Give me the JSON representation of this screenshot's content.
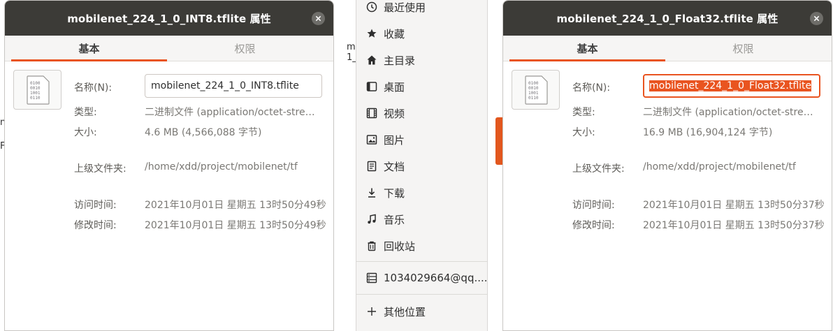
{
  "background": {
    "fragments": [
      "m\n1_",
      "n",
      "F"
    ],
    "accent_color": "#e2571e"
  },
  "sidebar": {
    "items": [
      {
        "icon": "clock-icon",
        "label": "最近使用"
      },
      {
        "icon": "star-icon",
        "label": "收藏"
      },
      {
        "icon": "home-icon",
        "label": "主目录"
      },
      {
        "icon": "desktop-icon",
        "label": "桌面"
      },
      {
        "icon": "video-icon",
        "label": "视频"
      },
      {
        "icon": "picture-icon",
        "label": "图片"
      },
      {
        "icon": "document-icon",
        "label": "文档"
      },
      {
        "icon": "download-icon",
        "label": "下载"
      },
      {
        "icon": "music-icon",
        "label": "音乐"
      },
      {
        "icon": "trash-icon",
        "label": "回收站"
      },
      {
        "icon": "network-server-icon",
        "label": "1034029664@qq...."
      },
      {
        "icon": "plus-icon",
        "label": "其他位置"
      }
    ]
  },
  "dialog_left": {
    "title": "mobilenet_224_1_0_INT8.tflite 属性",
    "tabs": [
      "基本",
      "权限"
    ],
    "active_tab": "基本",
    "name_label": "名称(N):",
    "name_value": "mobilenet_224_1_0_INT8.tflite",
    "type_label": "类型:",
    "type_value": "二进制文件 (application/octet-stream)",
    "size_label": "大小:",
    "size_value": "4.6 MB (4,566,088 字节)",
    "parent_label": "上级文件夹:",
    "parent_value": "/home/xdd/project/mobilenet/tf",
    "accessed_label": "访问时间:",
    "accessed_value": "2021年10月01日 星期五 13时50分49秒",
    "modified_label": "修改时间:",
    "modified_value": "2021年10月01日 星期五 13时50分49秒"
  },
  "dialog_right": {
    "title": "mobilenet_224_1_0_Float32.tflite 属性",
    "tabs": [
      "基本",
      "权限"
    ],
    "active_tab": "基本",
    "name_label": "名称(N):",
    "name_value": "mobilenet_224_1_0_Float32.tflite",
    "type_label": "类型:",
    "type_value": "二进制文件 (application/octet-stream)",
    "size_label": "大小:",
    "size_value": "16.9 MB (16,904,124 字节)",
    "parent_label": "上级文件夹:",
    "parent_value": "/home/xdd/project/mobilenet/tf",
    "accessed_label": "访问时间:",
    "accessed_value": "2021年10月01日 星期五 13时50分37秒",
    "modified_label": "修改时间:",
    "modified_value": "2021年10月01日 星期五 13时50分37秒"
  },
  "colors": {
    "header_bg": "#3c3b37",
    "accent": "#e95420",
    "selection_bg": "#e95420"
  }
}
